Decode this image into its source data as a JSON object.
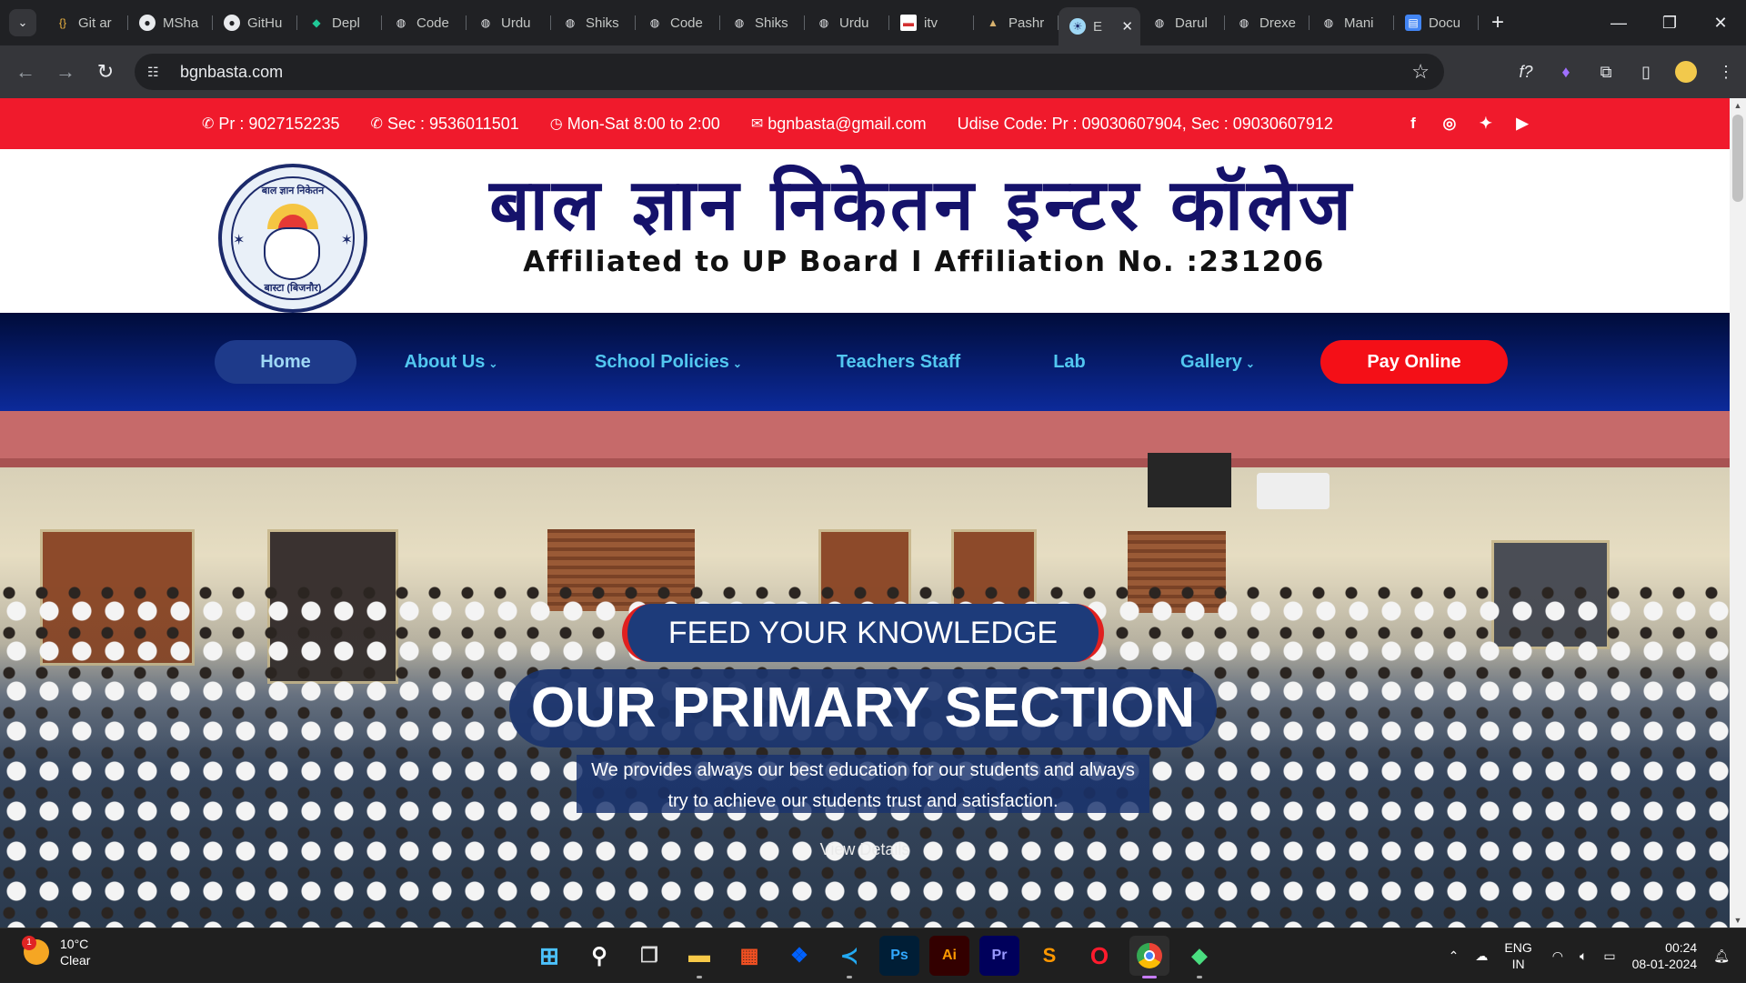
{
  "browser": {
    "tabs": [
      {
        "label": "Git ar",
        "icon": "code-icon"
      },
      {
        "label": "MSha",
        "icon": "github-icon"
      },
      {
        "label": "GitHu",
        "icon": "github-icon"
      },
      {
        "label": "Depl",
        "icon": "deploy-icon"
      },
      {
        "label": "Code",
        "icon": "globe-icon"
      },
      {
        "label": "Urdu",
        "icon": "globe-icon"
      },
      {
        "label": "Shiks",
        "icon": "globe-icon"
      },
      {
        "label": "Code",
        "icon": "globe-icon"
      },
      {
        "label": "Shiks",
        "icon": "globe-icon"
      },
      {
        "label": "Urdu",
        "icon": "globe-icon"
      },
      {
        "label": "itv",
        "icon": "itv-icon"
      },
      {
        "label": "Pashr",
        "icon": "pashr-icon"
      },
      {
        "label": "E",
        "icon": "school-logo-icon",
        "active": true
      },
      {
        "label": "Darul",
        "icon": "globe-icon"
      },
      {
        "label": "Drexe",
        "icon": "globe-icon"
      },
      {
        "label": "Mani",
        "icon": "globe-icon"
      },
      {
        "label": "Docu",
        "icon": "doc-icon"
      }
    ],
    "url": "bgnbasta.com"
  },
  "topbar": {
    "phone_pr": "Pr : 9027152235",
    "phone_sec": "Sec : 9536011501",
    "hours": "Mon-Sat 8:00 to 2:00",
    "email": "bgnbasta@gmail.com",
    "udise": "Udise Code: Pr : 09030607904, Sec : 09030607912",
    "social": [
      "facebook-icon",
      "instagram-icon",
      "twitter-icon",
      "youtube-icon"
    ]
  },
  "brand": {
    "name": "बाल ज्ञान निकेतन इन्टर कॉलेज",
    "affiliation": "Affiliated to UP Board I Affiliation No. :231206",
    "logo_top": "बाल ज्ञान निकेतन",
    "logo_bottom": "बास्टा (बिजनौर)"
  },
  "nav": {
    "home": "Home",
    "about": "About Us",
    "policies": "School Policies",
    "teachers": "Teachers Staff",
    "lab": "Lab",
    "gallery": "Gallery",
    "pay": "Pay Online"
  },
  "hero": {
    "slogan": "FEED YOUR KNOWLEDGE",
    "headline": "OUR PRIMARY SECTION",
    "desc_line1": "We provides always our best education for our students and always",
    "desc_line2": "try to achieve our students trust and satisfaction.",
    "cta": "View Details"
  },
  "taskbar": {
    "weather_temp": "10°C",
    "weather_desc": "Clear",
    "weather_badge": "1",
    "apps": [
      "windows-start",
      "search",
      "task-view",
      "file-explorer",
      "microsoft-store",
      "dropbox",
      "vscode",
      "photoshop",
      "illustrator",
      "premiere",
      "sublime",
      "opera",
      "chrome",
      "git-kraken"
    ],
    "lang_top": "ENG",
    "lang_bottom": "IN",
    "time": "00:24",
    "date": "08-01-2024"
  },
  "colors": {
    "topbar": "#f01a2c",
    "nav_text": "#52c7f0",
    "pay_button": "#f40f17",
    "brand_text": "#15126b"
  }
}
